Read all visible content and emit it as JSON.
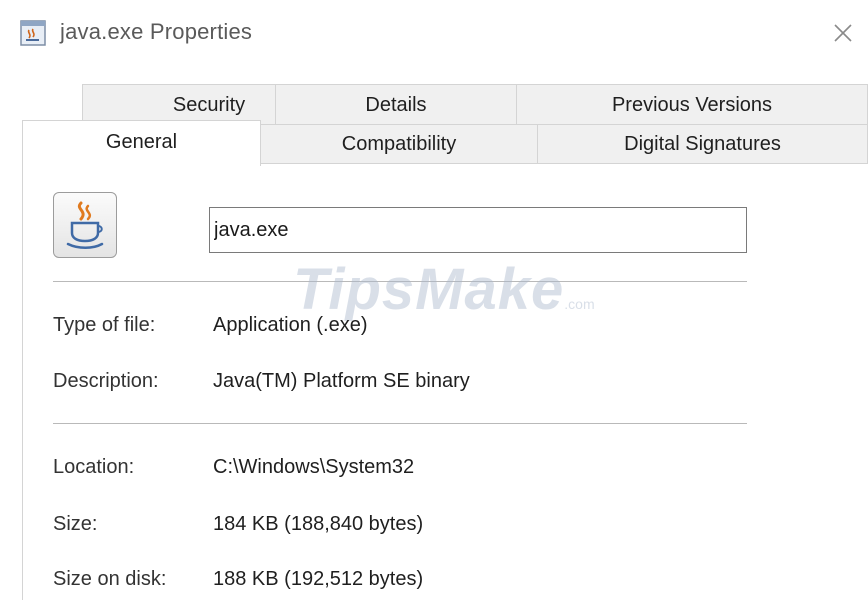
{
  "window": {
    "title": "java.exe Properties"
  },
  "tabs": {
    "row1": [
      {
        "label": "Security"
      },
      {
        "label": "Details"
      },
      {
        "label": "Previous Versions"
      }
    ],
    "row2": [
      {
        "label": "General",
        "active": true
      },
      {
        "label": "Compatibility"
      },
      {
        "label": "Digital Signatures"
      }
    ]
  },
  "general": {
    "file_icon": "java-cup-icon",
    "file_name": "java.exe",
    "type_of_file": {
      "label": "Type of file:",
      "value": "Application (.exe)"
    },
    "description": {
      "label": "Description:",
      "value": "Java(TM) Platform SE binary"
    },
    "location": {
      "label": "Location:",
      "value": "C:\\Windows\\System32"
    },
    "size": {
      "label": "Size:",
      "value": "184 KB (188,840 bytes)"
    },
    "size_on_disk": {
      "label": "Size on disk:",
      "value": "188 KB (192,512 bytes)"
    }
  },
  "watermark": {
    "text": "TipsMake",
    "suffix": ".com"
  },
  "colors": {
    "tab_background": "#f0f0f0",
    "tab_border": "#d4d4d4",
    "panel_background": "#ffffff",
    "title_text": "#5a5a5a"
  }
}
